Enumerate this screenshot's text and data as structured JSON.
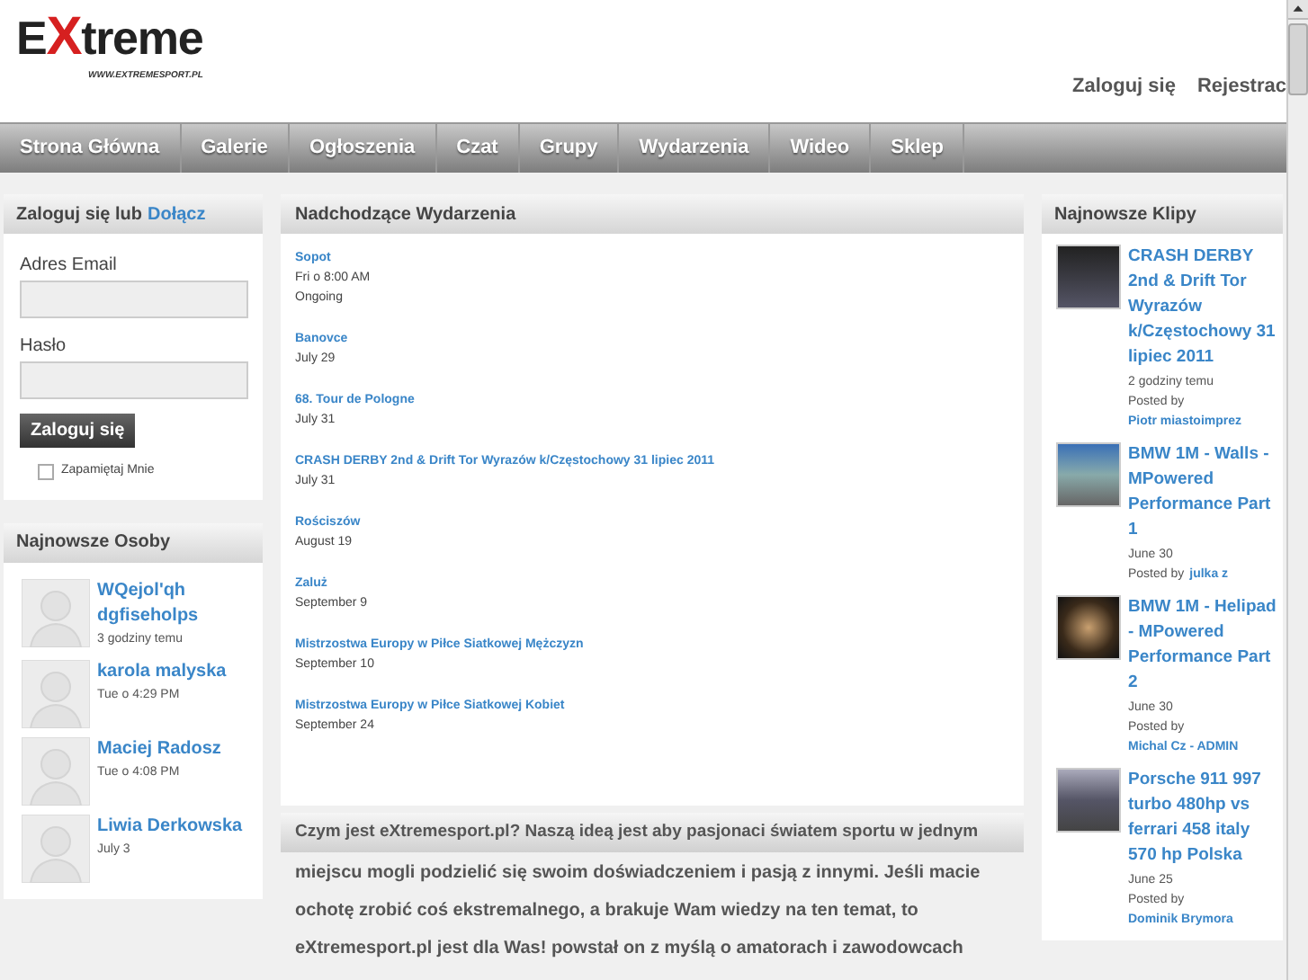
{
  "logo": {
    "prefix": "E",
    "mark": "X",
    "suffix": "treme",
    "url": "WWW.EXTREMESPORT.PL"
  },
  "top_links": [
    "Zaloguj się",
    "Rejestrac"
  ],
  "nav": [
    "Strona Główna",
    "Galerie",
    "Ogłoszenia",
    "Czat",
    "Grupy",
    "Wydarzenia",
    "Wideo",
    "Sklep"
  ],
  "login": {
    "title": "Zaloguj się lub",
    "join_link": "Dołącz",
    "email_label": "Adres Email",
    "password_label": "Hasło",
    "button": "Zaloguj się",
    "remember": {
      "label": "Zapamiętaj Mnie",
      "checked": false
    }
  },
  "people": {
    "title": "Najnowsze Osoby",
    "items": [
      {
        "name": "WQejol'qh dgfiseholps",
        "time": "3 godziny temu"
      },
      {
        "name": "karola malyska",
        "time": "Tue o 4:29 PM"
      },
      {
        "name": "Maciej Radosz",
        "time": "Tue o 4:08 PM"
      },
      {
        "name": "Liwia Derkowska",
        "time": "July 3"
      }
    ]
  },
  "events": {
    "title": "Nadchodzące Wydarzenia",
    "items": [
      {
        "title": "Sopot",
        "lines": [
          "Fri o 8:00 AM",
          "Ongoing"
        ]
      },
      {
        "title": "Banovce",
        "lines": [
          "July 29"
        ]
      },
      {
        "title": "68. Tour de Pologne",
        "lines": [
          "July 31"
        ]
      },
      {
        "title": "CRASH DERBY 2nd & Drift Tor Wyrazów k/Częstochowy 31 lipiec 2011",
        "lines": [
          "July 31"
        ]
      },
      {
        "title": "Rościszów",
        "lines": [
          "August 19"
        ]
      },
      {
        "title": "Zaluż",
        "lines": [
          "September 9"
        ]
      },
      {
        "title": "Mistrzostwa Europy w Piłce Siatkowej Mężczyzn",
        "lines": [
          "September 10"
        ]
      },
      {
        "title": "Mistrzostwa Europy w Piłce Siatkowej Kobiet",
        "lines": [
          "September 24"
        ]
      }
    ]
  },
  "about": {
    "heading": "Czym jest eXtremesport.pl? Naszą ideą jest aby pasjonaci światem sportu w jednym",
    "lines": [
      "miejscu mogli podzielić się swoim doświadczeniem i pasją z innymi. Jeśli macie",
      "ochotę zrobić coś ekstremalnego, a brakuje Wam wiedzy na ten temat, to",
      "eXtremesport.pl jest dla Was! powstał on z myślą o amatorach i zawodowcach"
    ]
  },
  "clips": {
    "title": "Najnowsze Klipy",
    "items": [
      {
        "title": "CRASH DERBY 2nd & Drift Tor Wyrazów k/Częstochowy 31 lipiec 2011",
        "time": "2 godziny temu",
        "posted_by": "Posted by",
        "author": "Piotr miastoimprez"
      },
      {
        "title": "BMW 1M - Walls - MPowered Performance Part 1",
        "time": "June 30",
        "posted_by": "Posted by",
        "author": "julka z"
      },
      {
        "title": "BMW 1M - Helipad - MPowered Performance Part 2",
        "time": "June 30",
        "posted_by": "Posted by",
        "author": "Michal Cz - ADMIN"
      },
      {
        "title": "Porsche 911 997 turbo 480hp vs ferrari 458 italy 570 hp Polska",
        "time": "June 25",
        "posted_by": "Posted by",
        "author": "Dominik Brymora"
      }
    ]
  }
}
